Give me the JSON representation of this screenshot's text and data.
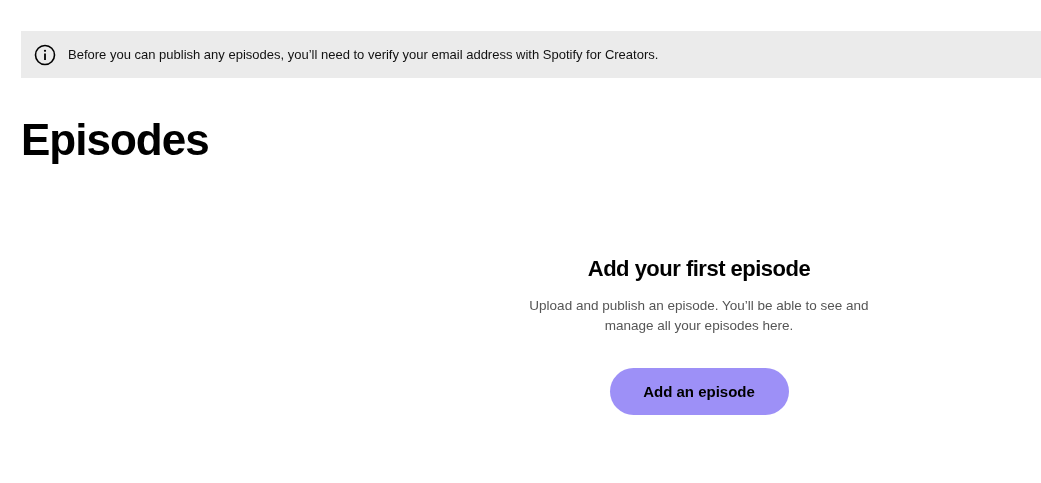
{
  "banner": {
    "text": "Before you can publish any episodes, you’ll need to verify your email address with Spotify for Creators."
  },
  "page_title": "Episodes",
  "empty_state": {
    "heading": "Add your first episode",
    "description": "Upload and publish an episode. You’ll be able to see and manage all your episodes here.",
    "button": "Add an episode"
  }
}
